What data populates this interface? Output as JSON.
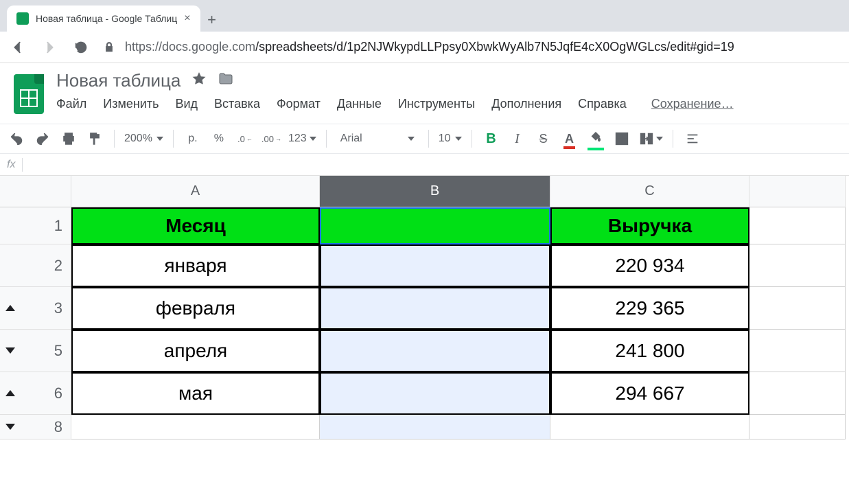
{
  "browser": {
    "tab_title": "Новая таблица - Google Таблиц",
    "url_host": "https://docs.google.com",
    "url_rest": "/spreadsheets/d/1p2NJWkypdLLPpsy0XbwkWyAlb7N5JqfE4cX0OgWGLcs/edit#gid=19"
  },
  "doc": {
    "title": "Новая таблица"
  },
  "menu": {
    "file": "Файл",
    "edit": "Изменить",
    "view": "Вид",
    "insert": "Вставка",
    "format": "Формат",
    "data": "Данные",
    "tools": "Инструменты",
    "addons": "Дополнения",
    "help": "Справка",
    "saving": "Сохранение…"
  },
  "toolbar": {
    "zoom": "200%",
    "currency": "р.",
    "percent": "%",
    "dec_dec": ".0",
    "inc_dec": ".00",
    "more_formats": "123",
    "font": "Arial",
    "font_size": "10",
    "bold": "B",
    "italic": "I",
    "strike": "S",
    "text_color": "A",
    "fill_color": "🪣"
  },
  "fx": {
    "label": "fx"
  },
  "columns": [
    "A",
    "B",
    "C"
  ],
  "selected_column": "B",
  "rows": [
    {
      "num": "1",
      "marker": ""
    },
    {
      "num": "2",
      "marker": ""
    },
    {
      "num": "3",
      "marker": "up"
    },
    {
      "num": "5",
      "marker": "down"
    },
    {
      "num": "6",
      "marker": "up"
    },
    {
      "num": "8",
      "marker": "down"
    }
  ],
  "sheet": {
    "header": {
      "A": "Месяц",
      "B": "",
      "C": "Выручка"
    },
    "data": [
      {
        "A": "января",
        "B": "",
        "C": "220 934"
      },
      {
        "A": "февраля",
        "B": "",
        "C": "229 365"
      },
      {
        "A": "апреля",
        "B": "",
        "C": "241 800"
      },
      {
        "A": "мая",
        "B": "",
        "C": "294 667"
      }
    ]
  }
}
